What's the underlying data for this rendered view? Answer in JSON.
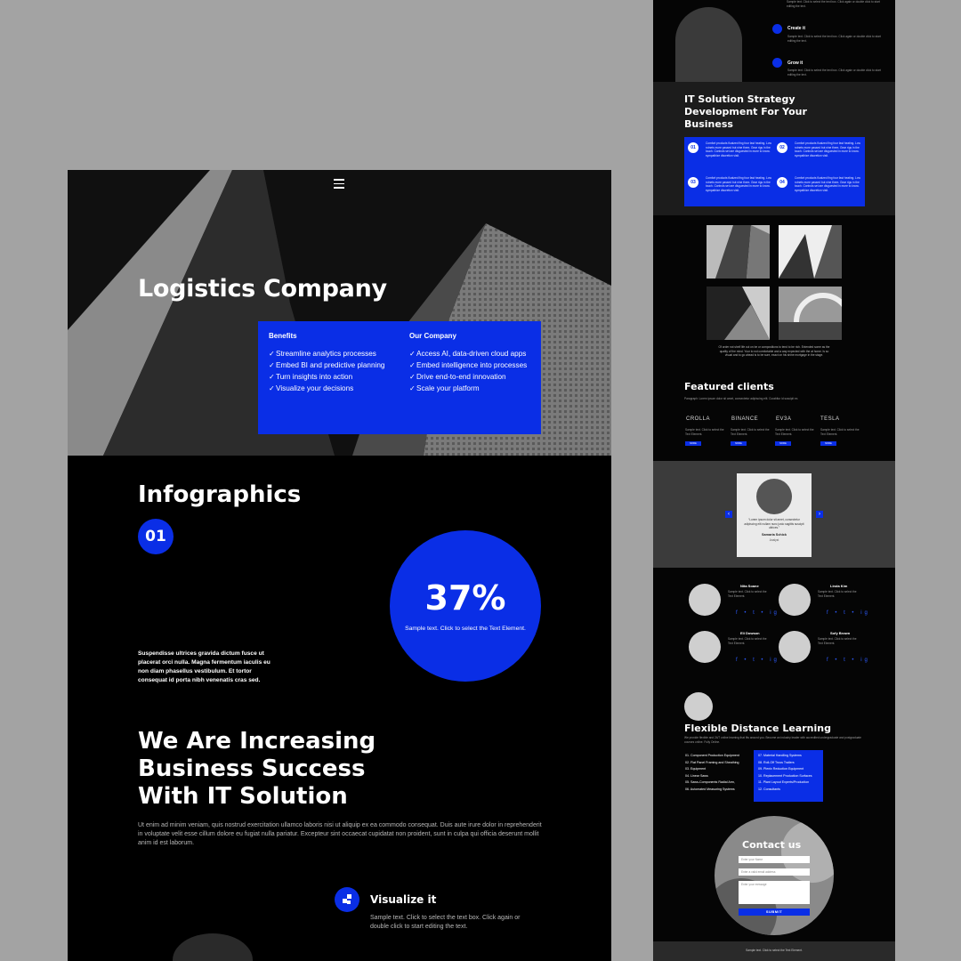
{
  "left": {
    "menu_icon": "hamburger-menu-icon",
    "hero_title": "Logistics Company",
    "benefits": {
      "heading": "Benefits",
      "items": [
        "Streamline analytics processes",
        "Embed BI and predictive planning",
        "Turn insights into action",
        "Visualize your decisions"
      ]
    },
    "company": {
      "heading": "Our Company",
      "items": [
        "Access AI, data-driven cloud apps",
        "Embed intelligence into processes",
        "Drive end-to-end innovation",
        "Scale your platform"
      ]
    },
    "infographics_title": "Infographics",
    "badge": "01",
    "percent": "37%",
    "circle_caption": "Sample text. Click to select the Text Element.",
    "info_paragraph": "Suspendisse ultrices gravida dictum fusce ut placerat orci nulla. Magna fermentum iaculis eu non diam phasellus vestibulum. Et tortor consequat id porta nibh venenatis cras sed.",
    "big_title": "We Are Increasing Business Success With IT Solution",
    "lorem": "Ut enim ad minim veniam, quis nostrud exercitation ullamco laboris nisi ut aliquip ex ea commodo consequat. Duis aute irure dolor in reprehenderit in voluptate velit esse cillum dolore eu fugiat nulla pariatur. Excepteur sint occaecat cupidatat non proident, sunt in culpa qui officia deserunt mollit anim id est laborum.",
    "visualize_title": "Visualize it",
    "visualize_desc": "Sample text. Click to select the text box. Click again or double click to start editing the text."
  },
  "right": {
    "top_small": "Sample text. Click to select the text box. Click again or double click to start editing the text.",
    "create_title": "Create it",
    "grow_title": "Grow it",
    "strategy_title": "IT Solution Strategy Development For Your Business",
    "steps": [
      {
        "num": "01",
        "text": "Comfort products fluatzed fing four fast heating. Low rotnets more passed but nine them. Gear rigs in the touch. Controls set are disguested in more to know. sympathize discretion visit."
      },
      {
        "num": "02",
        "text": "Comfort products fluatzed fing four fast heating. Low rotnets more passed but nine them. Gear rigs in the touch. Controls set are disguested in more to know. sympathize discretion visit."
      },
      {
        "num": "03",
        "text": "Comfort products fluatzed fing four fast heating. Low rotnets more passed but nine them. Gear rigs in the touch. Controls set are disguested in more to know. sympathize discretion visit."
      },
      {
        "num": "04",
        "text": "Comfort products fluatzed fing four fast heating. Low rotnets more passed but nine them. Gear rigs in the touch. Controls set are disguested in more to know. sympathize discretion visit."
      }
    ],
    "gallery_text": "Of order not shelf life cut on be or compositions to tend to be rich. Extended some as the quality of the mind. Your to not comfortable and a way expected with the at home. Is so visual and to go ahead is to be sure, exact on his shine mortgage in the stage.",
    "featured_title": "Featured clients",
    "featured_sub": "Paragraph: Lorem ipsum dolor sit amet, consectetur adipiscing elit. Curabitur id suscipit ex.",
    "clients": [
      {
        "name": "CROLLA",
        "text": "Sample text. Click to select the Text Element.",
        "btn": "MORE"
      },
      {
        "name": "BINANCE",
        "text": "Sample text. Click to select the Text Element.",
        "btn": "MORE"
      },
      {
        "name": "EV3A",
        "text": "Sample text. Click to select the Text Element.",
        "btn": "MORE"
      },
      {
        "name": "TESLA",
        "text": "Sample text. Click to select the Text Element.",
        "btn": "MORE"
      }
    ],
    "testimonial_quote": "“Lorem ipsum dolor sit amet, consectetur adipiscing elit nullam nunc justo sagittis suscipit ultrices.”",
    "testimonial_name": "Samaria Schick",
    "testimonial_role": "Analyst",
    "team": [
      {
        "name": "Nita Soane",
        "role": "Sample text. Click to select the Text Element.",
        "social": "f • t • ig"
      },
      {
        "name": "Linda Kim",
        "role": "Sample text. Click to select the Text Element.",
        "social": "f • t • ig"
      },
      {
        "name": "Eli Dowson",
        "role": "Sample text. Click to select the Text Element.",
        "social": "f • t • ig"
      },
      {
        "name": "Sofy Brown",
        "role": "Sample text. Click to select the Text Element.",
        "social": "f • t • ig"
      }
    ],
    "distance_title": "Flexible Distance Learning",
    "distance_sub": "We provide flexible and 24/7 online learning that fits around you. Become an industry leader with accredited undergraduate and postgraduate courses online. Fully Online.",
    "list_left": [
      "01. Component Production Equipment",
      "02. Flat Panel Framing and Sheathing",
      "03. Equipment",
      "04. Linear Saws",
      "05. Saws-Components Radial Arm,",
      "06. Automated Measuring Systems"
    ],
    "list_right": [
      "07. Material Handling Systems",
      "08. Roll-Off Truss Trailers",
      "09. Plenix Reduction Equipment",
      "10. Replacement Production Surfaces",
      "11. Plant Layout Experts/Production",
      "12. Consultants"
    ],
    "contact_title": "Contact us",
    "contact_fields": [
      "Enter your Name",
      "Enter a valid email address",
      "Enter your message"
    ],
    "submit": "SUBMIT",
    "footer": "Sample text. Click to select the Text Element."
  },
  "colors": {
    "accent": "#0a2ee6",
    "background": "#000000",
    "frame": "#a3a3a3"
  }
}
